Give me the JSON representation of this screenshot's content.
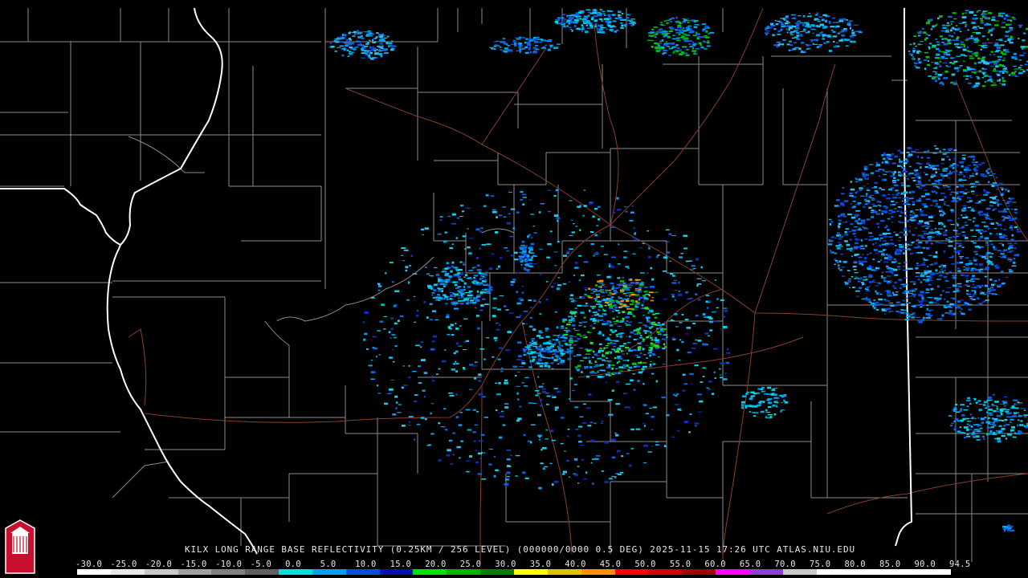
{
  "product_caption": "KILX LONG RANGE BASE REFLECTIVITY (0.25KM / 256 LEVEL) (000000/0000 0.5 DEG) 2025-11-15 17:26 UTC  ATLAS.NIU.EDU",
  "scale": {
    "labels": [
      "-30.0",
      "-25.0",
      "-20.0",
      "-15.0",
      "-10.0",
      "-5.0",
      "0.0",
      "5.0",
      "10.0",
      "15.0",
      "20.0",
      "25.0",
      "30.0",
      "35.0",
      "40.0",
      "45.0",
      "50.0",
      "55.0",
      "60.0",
      "65.0",
      "70.0",
      "75.0",
      "80.0",
      "85.0",
      "90.0",
      "94.5"
    ],
    "colors": [
      "#ffffff",
      "#e8e8e8",
      "#c8c8c8",
      "#a0a0a0",
      "#808080",
      "#606060",
      "#00e0e0",
      "#00a0f0",
      "#0050e0",
      "#0010b0",
      "#00e000",
      "#00b400",
      "#008000",
      "#ffff00",
      "#e0c000",
      "#ff9000",
      "#ff0000",
      "#d40000",
      "#a00000",
      "#ff00ff",
      "#9040d0",
      "#c8c8c8",
      "#ffffff",
      "#ffffff",
      "#ffffff",
      "#ffffff"
    ]
  },
  "logo": {
    "text": "NIU",
    "color": "#c8102e"
  },
  "map": {
    "background": "#000000",
    "county_line_color": "#8c8c8c",
    "state_line_color": "#ffffff",
    "road_color": "#8a3f2a",
    "radar_site": "KILX"
  }
}
